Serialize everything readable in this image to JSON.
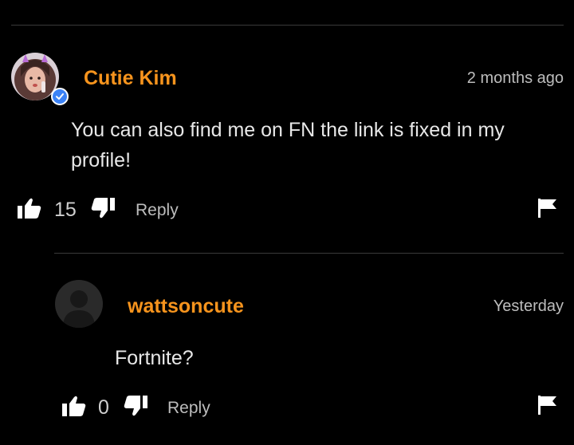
{
  "comments": [
    {
      "username": "Cutie Kim",
      "timestamp": "2 months ago",
      "text": "You can also find me on FN the link is fixed in my profile!",
      "likes": "15",
      "reply_label": "Reply",
      "verified": true
    },
    {
      "username": "wattsoncute",
      "timestamp": "Yesterday",
      "text": "Fortnite?",
      "likes": "0",
      "reply_label": "Reply",
      "verified": false
    }
  ],
  "colors": {
    "background": "#000000",
    "username": "#f7941d",
    "divider": "#3a3a3a",
    "verified_badge": "#3b82f6"
  },
  "icons": [
    "thumbs-up-icon",
    "thumbs-down-icon",
    "flag-icon",
    "verified-check-icon"
  ]
}
